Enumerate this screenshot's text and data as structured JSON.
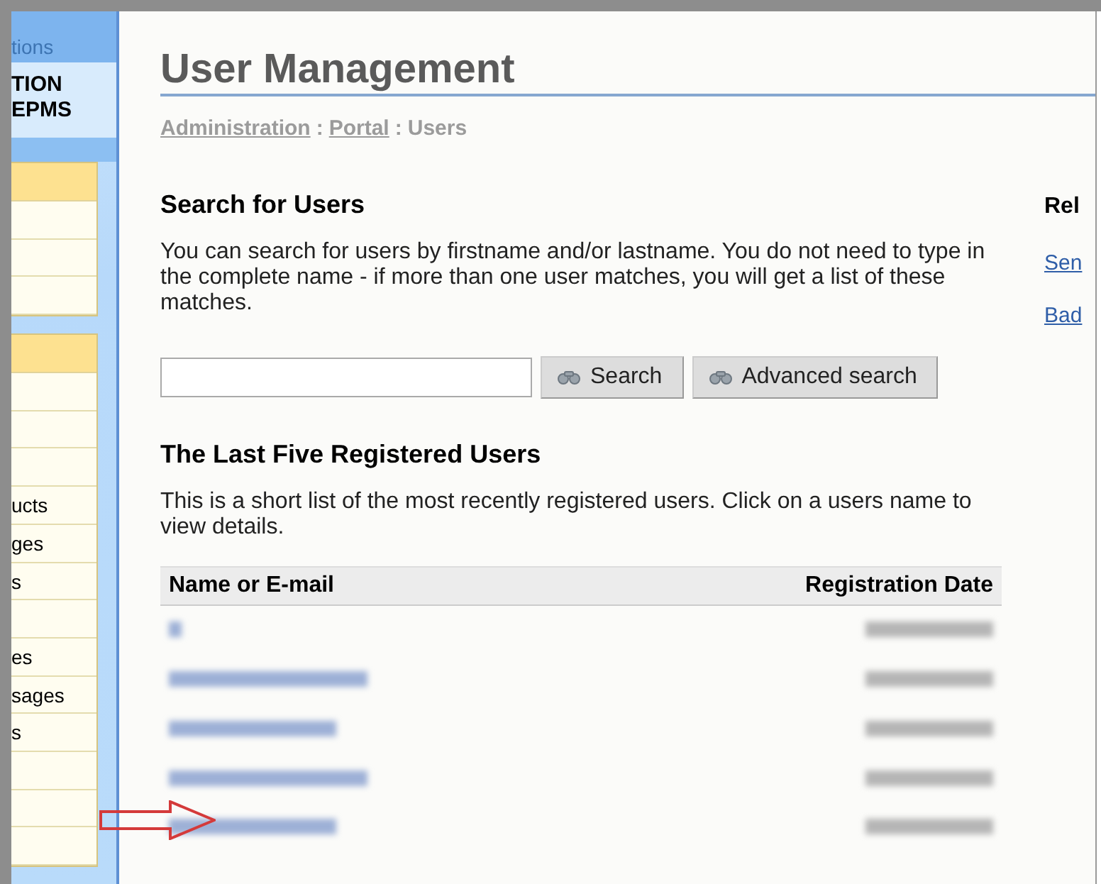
{
  "sidebar": {
    "header_fragment": "tions",
    "title_lines": [
      "TION",
      "EPMS"
    ],
    "menu_groups": [
      {
        "items": [
          {
            "kind": "blank"
          },
          {
            "kind": "blank"
          },
          {
            "kind": "blank"
          }
        ]
      },
      {
        "items": [
          {
            "kind": "blank"
          },
          {
            "kind": "blank"
          },
          {
            "kind": "blank"
          },
          {
            "kind": "text",
            "label": "ucts"
          },
          {
            "kind": "text",
            "label": "ges"
          },
          {
            "kind": "text",
            "label": "s"
          },
          {
            "kind": "blank"
          },
          {
            "kind": "text",
            "label": "es"
          },
          {
            "kind": "text",
            "label": "sages"
          },
          {
            "kind": "text",
            "label": "s"
          },
          {
            "kind": "blank"
          },
          {
            "kind": "blank"
          },
          {
            "kind": "blank"
          }
        ]
      }
    ]
  },
  "page": {
    "title": "User Management",
    "breadcrumb": [
      {
        "kind": "link",
        "text": "Administration"
      },
      {
        "kind": "separator",
        "text": ":"
      },
      {
        "kind": "link",
        "text": "Portal"
      },
      {
        "kind": "separator",
        "text": ":"
      },
      {
        "kind": "current",
        "text": "Users"
      }
    ],
    "search_section": {
      "heading": "Search for Users",
      "description": "You can search for users by firstname and/or lastname. You do not need to type in the complete name - if more than one user matches, you will get a list of these matches.",
      "buttons": [
        "Search",
        "Advanced search"
      ]
    },
    "recent_section": {
      "heading": "The Last Five Registered Users",
      "description": "This is a short list of the most recently registered users. Click on a users name to view details.",
      "table": {
        "columns": [
          "Name or E-mail",
          "Registration Date"
        ],
        "rows": [
          {
            "kind": "blurred"
          },
          {
            "kind": "blurred"
          },
          {
            "kind": "blurred"
          },
          {
            "kind": "blurred"
          },
          {
            "kind": "blurred"
          }
        ]
      }
    },
    "related": {
      "heading": "Rel",
      "links": [
        "Sen",
        "Bad"
      ]
    }
  },
  "annotations": [
    {
      "kind": "arrow"
    }
  ]
}
